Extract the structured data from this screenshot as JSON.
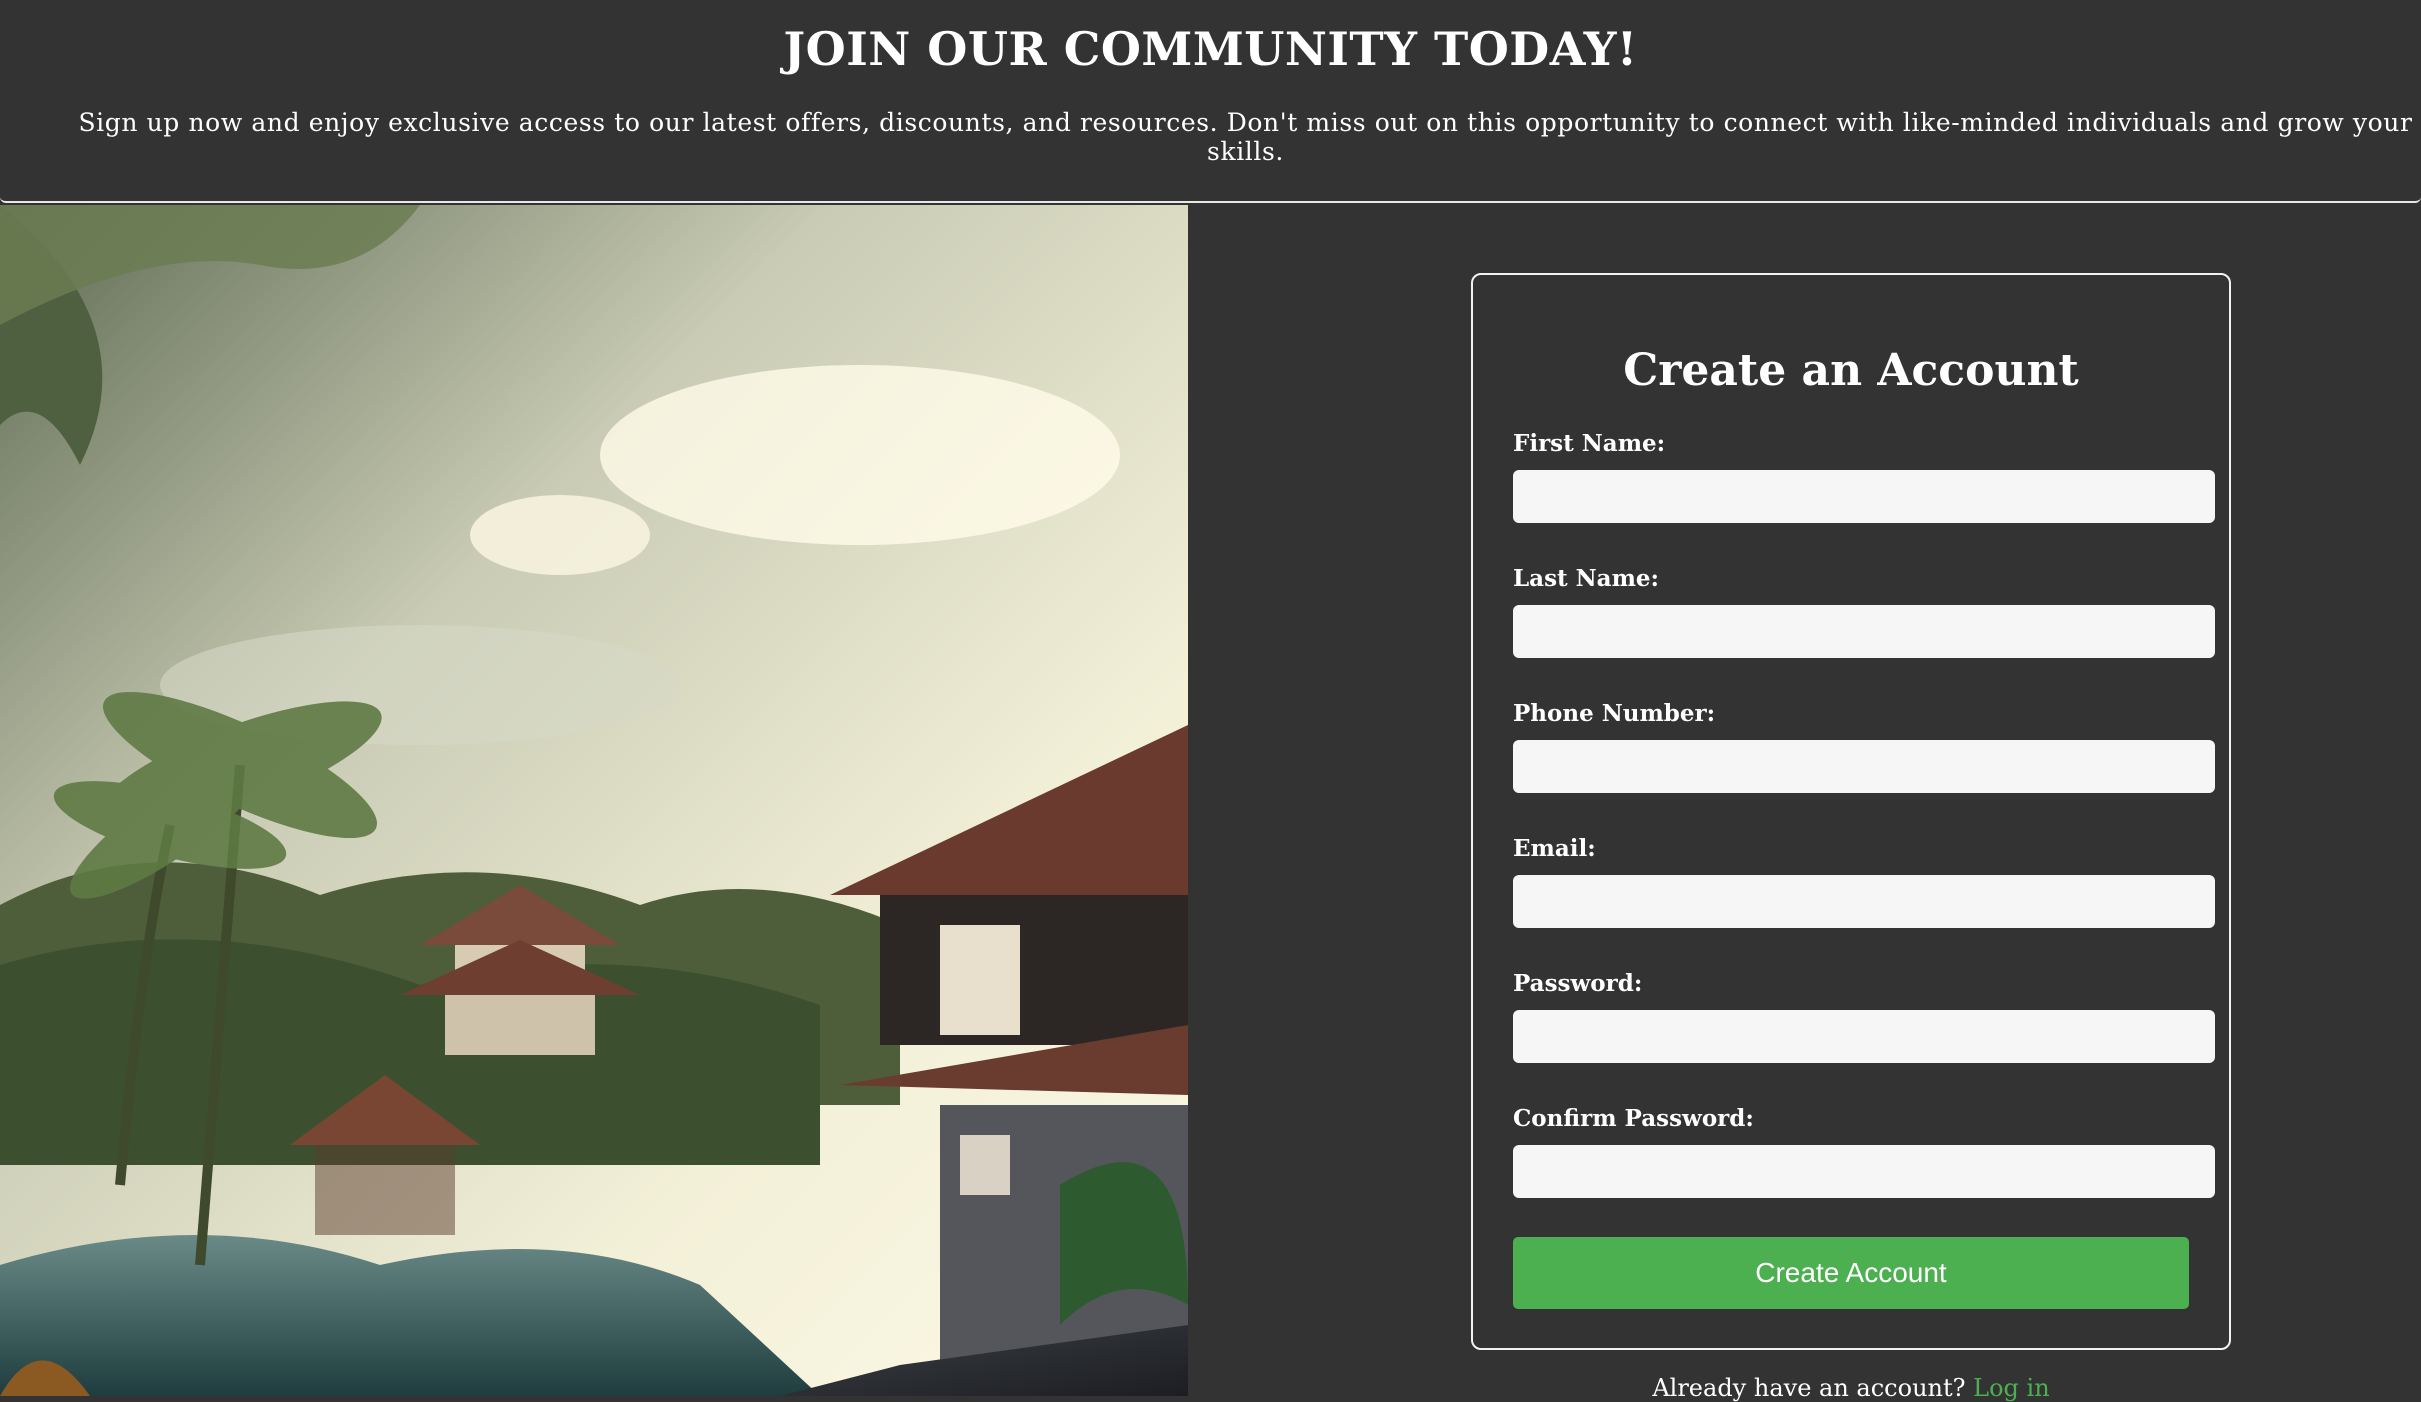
{
  "header": {
    "title": "JOIN OUR COMMUNITY TODAY!",
    "subtitle": "Sign up now and enjoy exclusive access to our latest offers, discounts, and resources. Don't miss out on this opportunity to connect with like-minded individuals and grow your skills."
  },
  "form": {
    "title": "Create an Account",
    "fields": [
      {
        "label": "First Name:",
        "value": ""
      },
      {
        "label": "Last Name:",
        "value": ""
      },
      {
        "label": "Phone Number:",
        "value": ""
      },
      {
        "label": "Email:",
        "value": ""
      },
      {
        "label": "Password:",
        "value": ""
      },
      {
        "label": "Confirm Password:",
        "value": ""
      }
    ],
    "submit_label": "Create Account"
  },
  "footer": {
    "prompt": "Already have an account?",
    "login_link": "Log in"
  },
  "colors": {
    "background": "#333333",
    "accent": "#4caf50",
    "input_bg": "#f6f6f6"
  },
  "hero": {
    "icon": "tropical-resort-illustration"
  }
}
